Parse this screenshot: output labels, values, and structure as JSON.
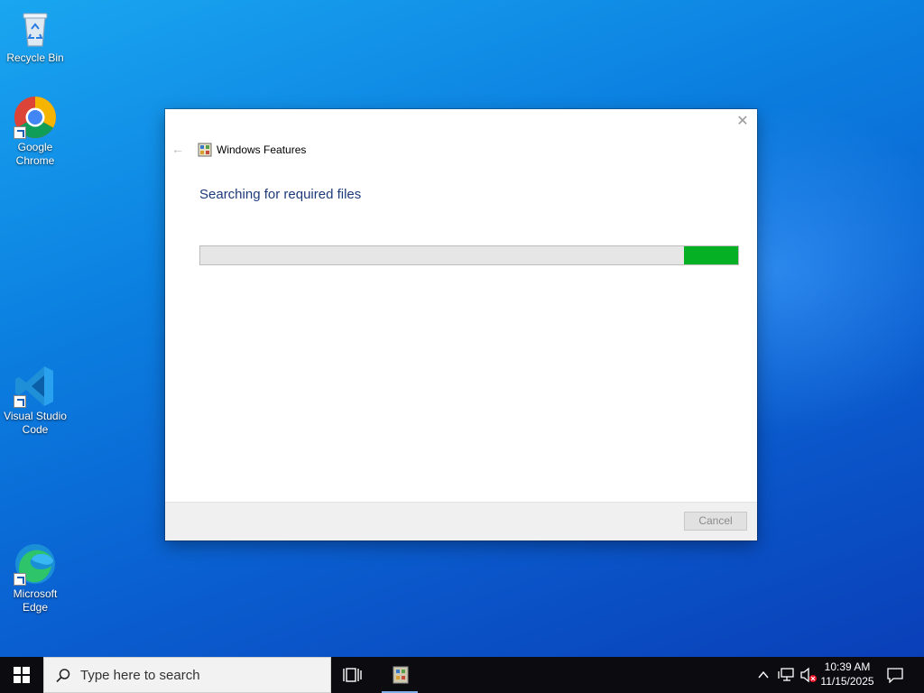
{
  "desktop": {
    "icons": [
      {
        "label": "Recycle Bin",
        "icon": "recycle-bin-icon"
      },
      {
        "label": "Google Chrome",
        "icon": "chrome-icon"
      },
      {
        "label": "Visual Studio Code",
        "icon": "vscode-icon"
      },
      {
        "label": "Microsoft Edge",
        "icon": "edge-icon"
      }
    ]
  },
  "dialog": {
    "title": "Windows Features",
    "heading": "Searching for required files",
    "progress": {
      "indeterminate": true,
      "segment_start": 0.9,
      "segment_end": 1.0,
      "color": "#06b025"
    },
    "cancel_label": "Cancel",
    "close_icon": "close-icon",
    "back_icon": "back-arrow-icon"
  },
  "taskbar": {
    "search_placeholder": "Type here to search",
    "clock_time": "10:39 AM",
    "clock_date": "11/15/2025",
    "active_app_icon": "windows-features-icon"
  },
  "colors": {
    "heading": "#1e3a78",
    "progress_fill": "#06b025",
    "taskbar": "#0c0c10"
  }
}
